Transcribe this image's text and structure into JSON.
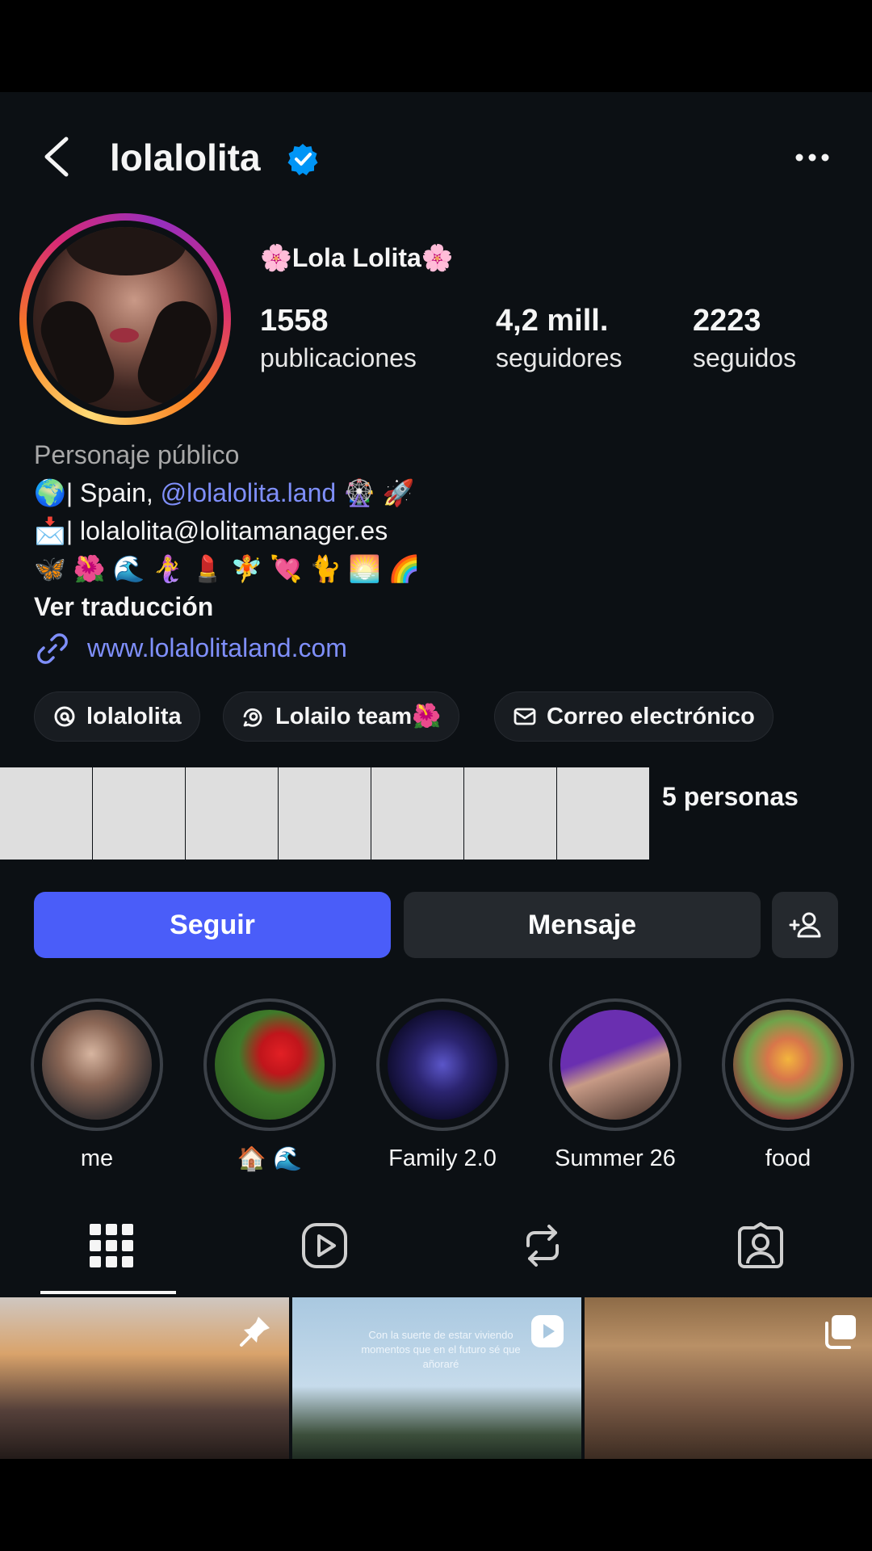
{
  "header": {
    "username": "lolalolita"
  },
  "profile": {
    "display_name": "🌸Lola Lolita🌸",
    "stats": [
      {
        "value": "1558",
        "label": "publicaciones"
      },
      {
        "value": "4,2 mill.",
        "label": "seguidores"
      },
      {
        "value": "2223",
        "label": "seguidos"
      }
    ]
  },
  "bio": {
    "category": "Personaje público",
    "line1_prefix": "🌍| Spain, ",
    "line1_mention": "@lolalolita.land",
    "line1_suffix": " 🎡 🚀",
    "line2": "📩| lolalolita@lolitamanager.es",
    "line3": "🦋 🌺 🌊 🧜‍♀️ 💄 🧚 💘 🐈 🌅 🌈",
    "translate": "Ver traducción",
    "link": "www.lolalolitaland.com"
  },
  "chips": [
    {
      "label": "lolalolita",
      "icon": "threads-icon"
    },
    {
      "label": "Lolailo team🌺",
      "icon": "channel-icon"
    },
    {
      "label": "Correo electrónico",
      "icon": "mail-icon"
    }
  ],
  "followed_by": {
    "text": "5 personas"
  },
  "actions": {
    "follow": "Seguir",
    "message": "Mensaje"
  },
  "highlights": [
    {
      "label": "me"
    },
    {
      "label": "🏠 🌊"
    },
    {
      "label": "Family 2.0"
    },
    {
      "label": "Summer 26"
    },
    {
      "label": "food"
    }
  ],
  "posts": {
    "post2_caption": "Con la suerte de estar viviendo momentos que en el futuro sé que añoraré"
  },
  "colors": {
    "background": "#0c1014",
    "accent_blue": "#4a5df9",
    "link_blue": "#7f8ffb",
    "verified_blue": "#0095f6"
  }
}
